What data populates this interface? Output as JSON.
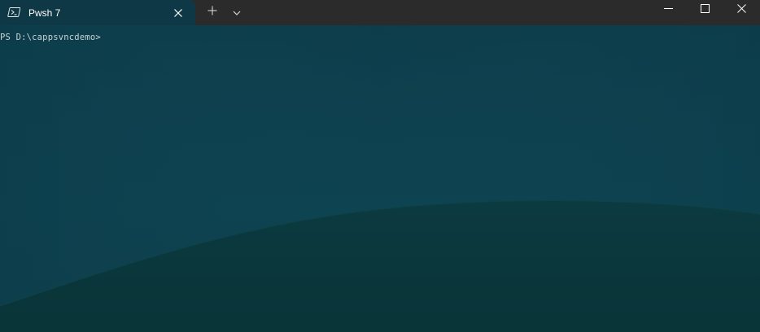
{
  "tab": {
    "title": "Pwsh 7",
    "icon": "powershell-icon"
  },
  "toolbar": {
    "new_tab_icon": "plus-icon",
    "dropdown_icon": "chevron-down-icon"
  },
  "window_controls": {
    "minimize_icon": "minimize-icon",
    "maximize_icon": "maximize-icon",
    "close_icon": "close-icon"
  },
  "terminal": {
    "prompt": "PS D:\\cappsvncdemo>"
  },
  "colors": {
    "titlebar": "#2b2b2b",
    "tab_background": "#0f3846",
    "terminal_background": "#0e4150",
    "hill": "#0a3a3f",
    "text": "#c9d3d6"
  }
}
